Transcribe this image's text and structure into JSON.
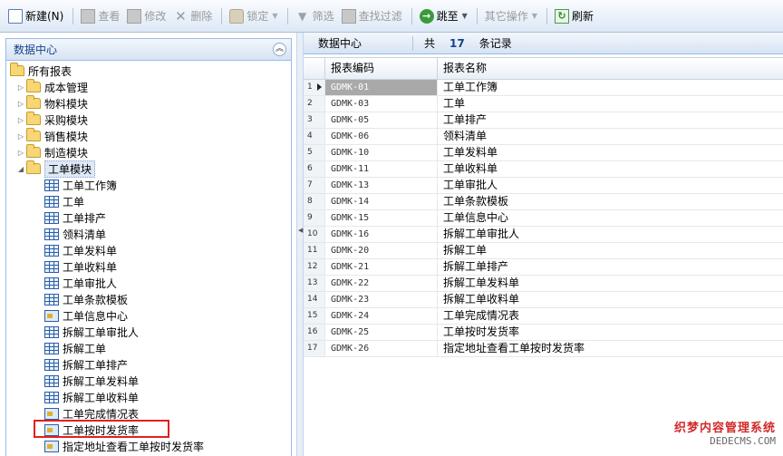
{
  "toolbar": {
    "new": "新建(N)",
    "view": "查看",
    "edit": "修改",
    "delete": "删除",
    "lock": "锁定",
    "filter": "筛选",
    "search_filter": "查找过滤",
    "goto": "跳至",
    "other_ops": "其它操作",
    "refresh": "刷新"
  },
  "left_panel": {
    "title": "数据中心",
    "tree": {
      "root": "所有报表",
      "modules": [
        "成本管理",
        "物料模块",
        "采购模块",
        "销售模块",
        "制造模块"
      ],
      "expanded_module": "工单模块",
      "reports": [
        {
          "label": "工单工作簿",
          "icon": "grid-icon"
        },
        {
          "label": "工单",
          "icon": "grid-icon"
        },
        {
          "label": "工单排产",
          "icon": "grid-icon"
        },
        {
          "label": "领料清单",
          "icon": "grid-icon"
        },
        {
          "label": "工单发料单",
          "icon": "grid-icon"
        },
        {
          "label": "工单收料单",
          "icon": "grid-icon"
        },
        {
          "label": "工单审批人",
          "icon": "grid-icon"
        },
        {
          "label": "工单条款模板",
          "icon": "grid-icon"
        },
        {
          "label": "工单信息中心",
          "icon": "form-icon"
        },
        {
          "label": "拆解工单审批人",
          "icon": "grid-icon"
        },
        {
          "label": "拆解工单",
          "icon": "grid-icon"
        },
        {
          "label": "拆解工单排产",
          "icon": "grid-icon"
        },
        {
          "label": "拆解工单发料单",
          "icon": "grid-icon"
        },
        {
          "label": "拆解工单收料单",
          "icon": "grid-icon"
        },
        {
          "label": "工单完成情况表",
          "icon": "form-icon"
        },
        {
          "label": "工单按时发货率",
          "icon": "form-icon"
        },
        {
          "label": "指定地址查看工单按时发货率",
          "icon": "form-icon"
        }
      ]
    }
  },
  "right_panel": {
    "title": "数据中心",
    "count_prefix": "共",
    "count": "17",
    "count_suffix": "条记录",
    "columns": [
      "报表编码",
      "报表名称"
    ],
    "rows": [
      {
        "no": "1",
        "code": "GDMK-01",
        "name": "工单工作簿"
      },
      {
        "no": "2",
        "code": "GDMK-03",
        "name": "工单"
      },
      {
        "no": "3",
        "code": "GDMK-05",
        "name": "工单排产"
      },
      {
        "no": "4",
        "code": "GDMK-06",
        "name": "领料清单"
      },
      {
        "no": "5",
        "code": "GDMK-10",
        "name": "工单发料单"
      },
      {
        "no": "6",
        "code": "GDMK-11",
        "name": "工单收料单"
      },
      {
        "no": "7",
        "code": "GDMK-13",
        "name": "工单审批人"
      },
      {
        "no": "8",
        "code": "GDMK-14",
        "name": "工单条款模板"
      },
      {
        "no": "9",
        "code": "GDMK-15",
        "name": "工单信息中心"
      },
      {
        "no": "10",
        "code": "GDMK-16",
        "name": "拆解工单审批人"
      },
      {
        "no": "11",
        "code": "GDMK-20",
        "name": "拆解工单"
      },
      {
        "no": "12",
        "code": "GDMK-21",
        "name": "拆解工单排产"
      },
      {
        "no": "13",
        "code": "GDMK-22",
        "name": "拆解工单发料单"
      },
      {
        "no": "14",
        "code": "GDMK-23",
        "name": "拆解工单收料单"
      },
      {
        "no": "15",
        "code": "GDMK-24",
        "name": "工单完成情况表"
      },
      {
        "no": "16",
        "code": "GDMK-25",
        "name": "工单按时发货率"
      },
      {
        "no": "17",
        "code": "GDMK-26",
        "name": "指定地址查看工单按时发货率"
      }
    ]
  },
  "watermark": {
    "line1": "织梦内容管理系统",
    "line2": "DEDECMS.COM"
  }
}
